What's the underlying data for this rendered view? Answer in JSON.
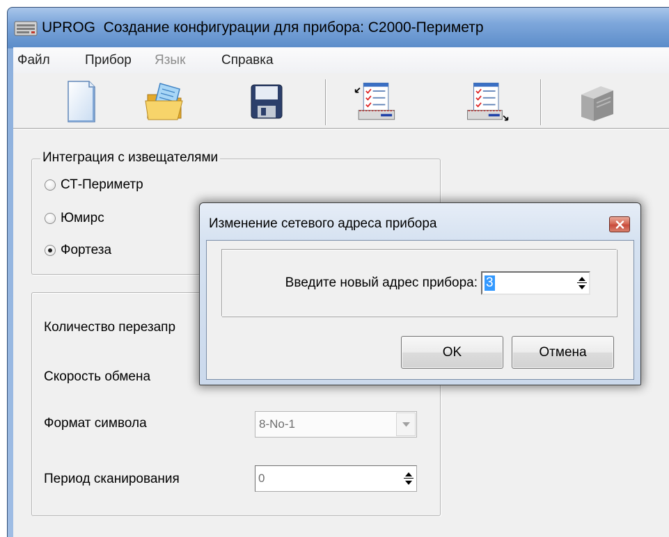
{
  "window": {
    "title": "UPROG  Создание конфигурации для прибора: С2000-Периметр",
    "icon": "uprog-app-icon"
  },
  "menu": [
    {
      "label": "Файл",
      "enabled": true
    },
    {
      "label": "Прибор",
      "enabled": true
    },
    {
      "label": "Язык",
      "enabled": false
    },
    {
      "label": "Справка",
      "enabled": true
    }
  ],
  "toolbar": [
    {
      "icon": "new-document-icon",
      "enabled": true
    },
    {
      "icon": "open-folder-icon",
      "enabled": true
    },
    {
      "icon": "save-floppy-icon",
      "enabled": true
    },
    {
      "icon": "read-config-icon",
      "enabled": true
    },
    {
      "icon": "write-config-icon",
      "enabled": true
    },
    {
      "icon": "device-icon",
      "enabled": false
    }
  ],
  "integration": {
    "legend": "Интеграция с извещателями",
    "options": [
      "СТ-Периметр",
      "Юмирс",
      "Фортеза"
    ],
    "selected_index": 2
  },
  "settings": {
    "retries_label": "Количество перезапр",
    "speed_label": "Скорость обмена",
    "format_label": "Формат символа",
    "format_value": "8-No-1",
    "format_enabled": false,
    "scan_label": "Период сканирования",
    "scan_value": "0",
    "scan_enabled": false
  },
  "dialog": {
    "title": "Изменение сетевого адреса прибора",
    "prompt": "Введите новый адрес прибора:",
    "address_value": "3",
    "ok_label": "OK",
    "cancel_label": "Отмена",
    "close_icon": "close-icon"
  },
  "colors": {
    "title_bar": "#5b8cc9",
    "selection": "#3399ff",
    "close_button": "#c94a3b",
    "disabled_text": "#8c8c8c"
  }
}
